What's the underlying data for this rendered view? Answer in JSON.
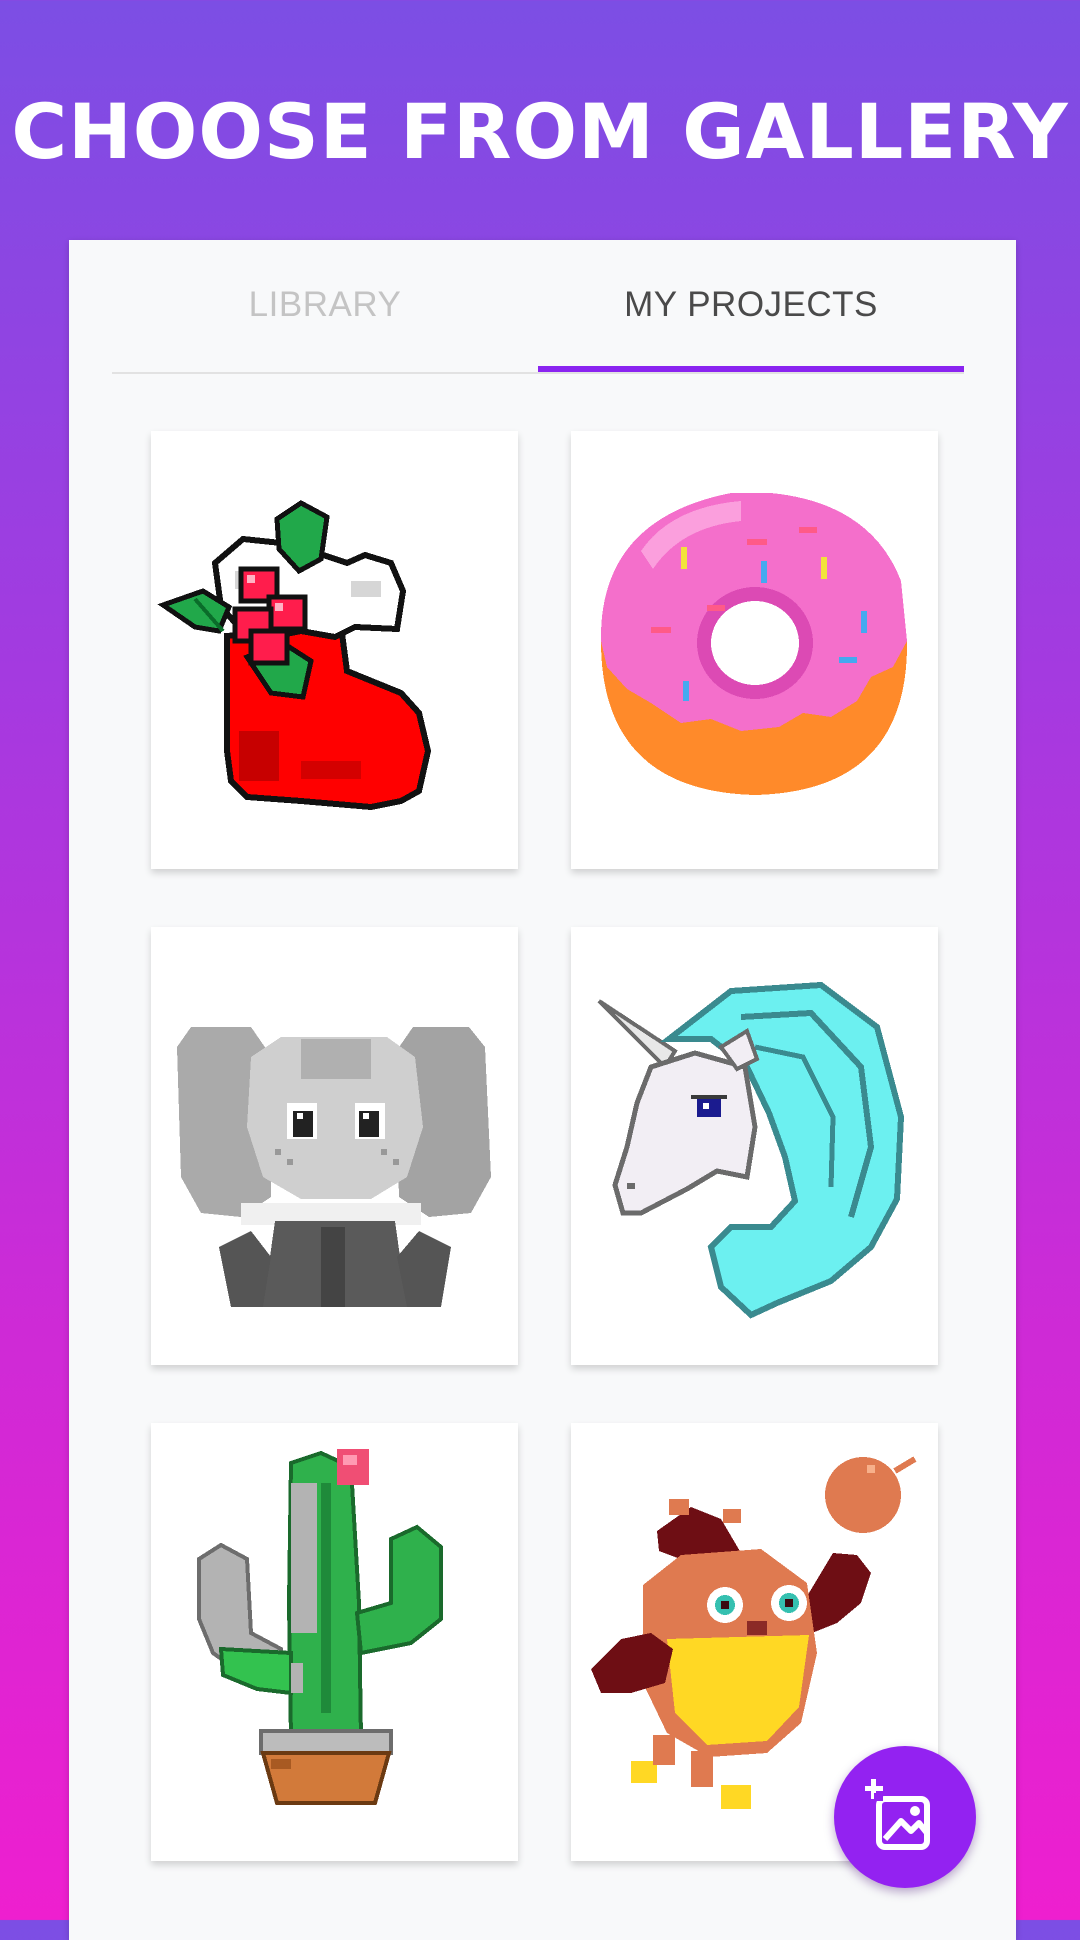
{
  "banner": {
    "title": "CHOOSE FROM GALLERY"
  },
  "tabs": [
    {
      "label": "LIBRARY",
      "selected": false
    },
    {
      "label": "MY PROJECTS",
      "selected": true
    }
  ],
  "projects": [
    {
      "subject": "christmas-stocking"
    },
    {
      "subject": "donut"
    },
    {
      "subject": "elephant"
    },
    {
      "subject": "unicorn"
    },
    {
      "subject": "cactus"
    },
    {
      "subject": "bird-with-ball"
    }
  ],
  "fab": {
    "icon": "add-image-icon"
  },
  "colors": {
    "accent": "#8a24f0",
    "fab": "#9322f1",
    "gradient_top": "#7c4ee4",
    "gradient_bottom": "#ee1fcf",
    "tab_inactive": "#c4c4c4",
    "tab_active": "#4a4a4a"
  }
}
